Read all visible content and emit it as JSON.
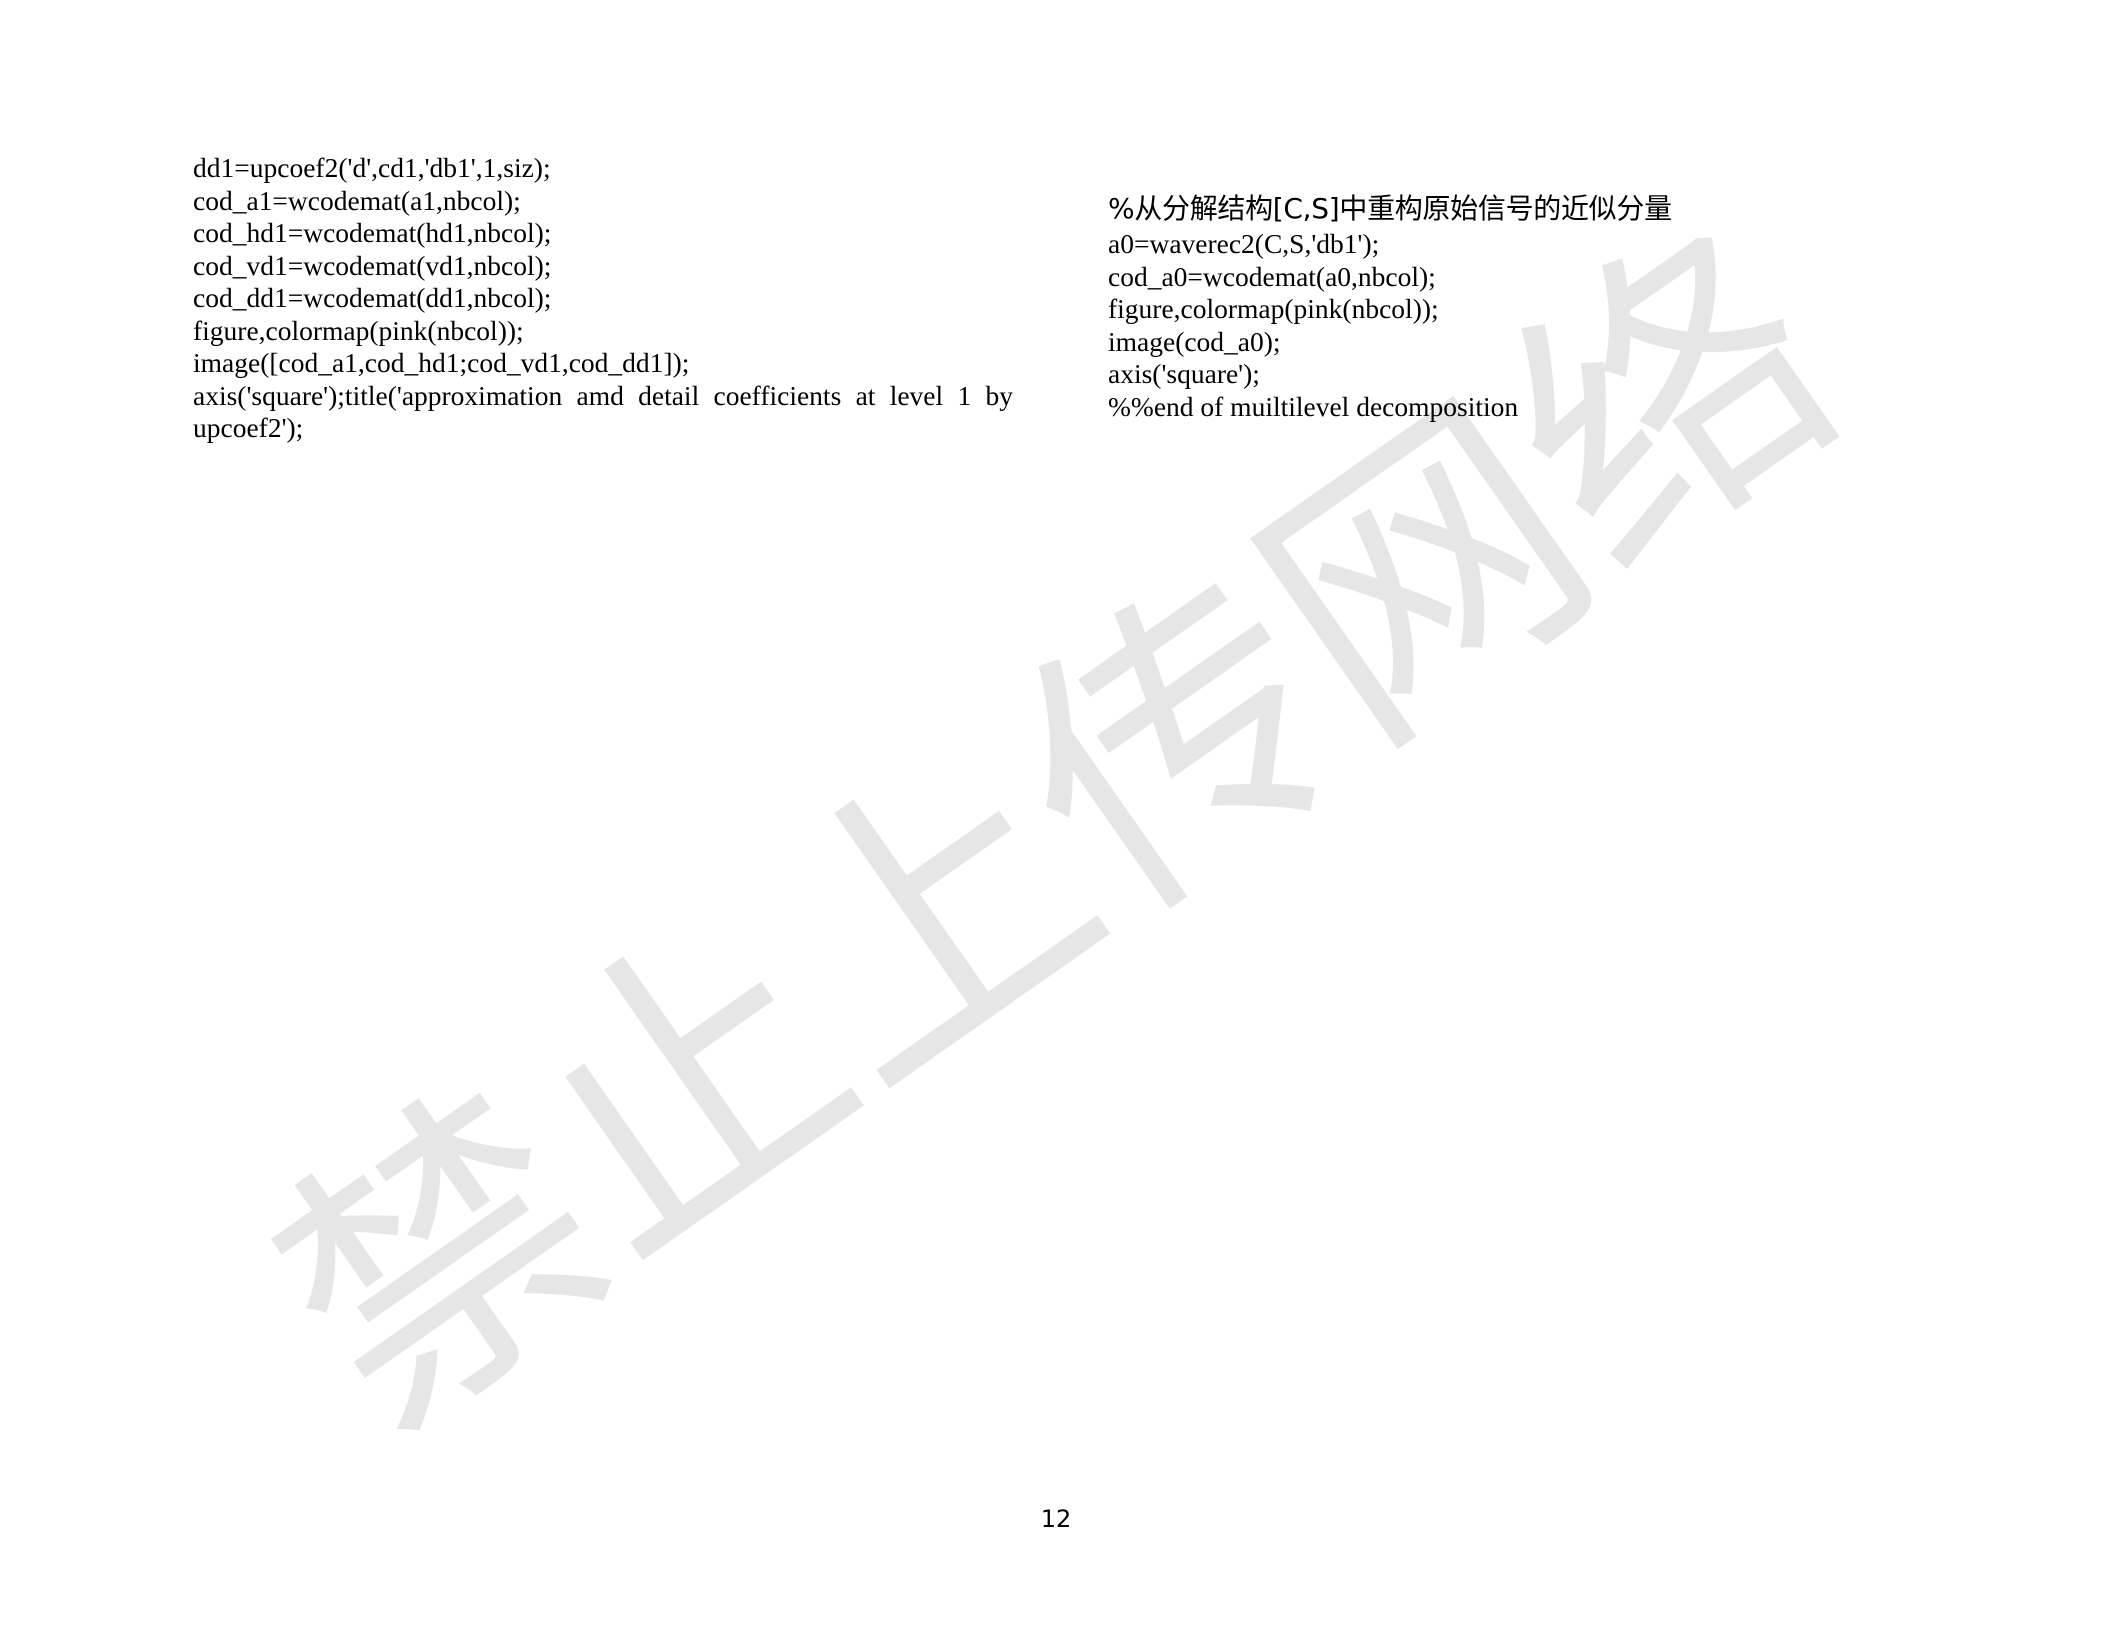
{
  "left_column": {
    "lines": [
      "dd1=upcoef2('d',cd1,'db1',1,siz);",
      "cod_a1=wcodemat(a1,nbcol);",
      "cod_hd1=wcodemat(hd1,nbcol);",
      "cod_vd1=wcodemat(vd1,nbcol);",
      "cod_dd1=wcodemat(dd1,nbcol);",
      "figure,colormap(pink(nbcol));",
      "image([cod_a1,cod_hd1;cod_vd1,cod_dd1]);",
      "axis('square');title('approximation amd detail coefficients at level 1 by",
      "upcoef2');"
    ]
  },
  "right_column": {
    "heading": "%从分解结构[C,S]中重构原始信号的近似分量",
    "lines": [
      "a0=waverec2(C,S,'db1');",
      "cod_a0=wcodemat(a0,nbcol);",
      "figure,colormap(pink(nbcol));",
      "image(cod_a0);",
      "axis('square');",
      "%%end of muiltilevel decomposition"
    ]
  },
  "page_number": "12",
  "watermark": {
    "text": "禁止上传网络",
    "color": "#e6e6e6"
  }
}
